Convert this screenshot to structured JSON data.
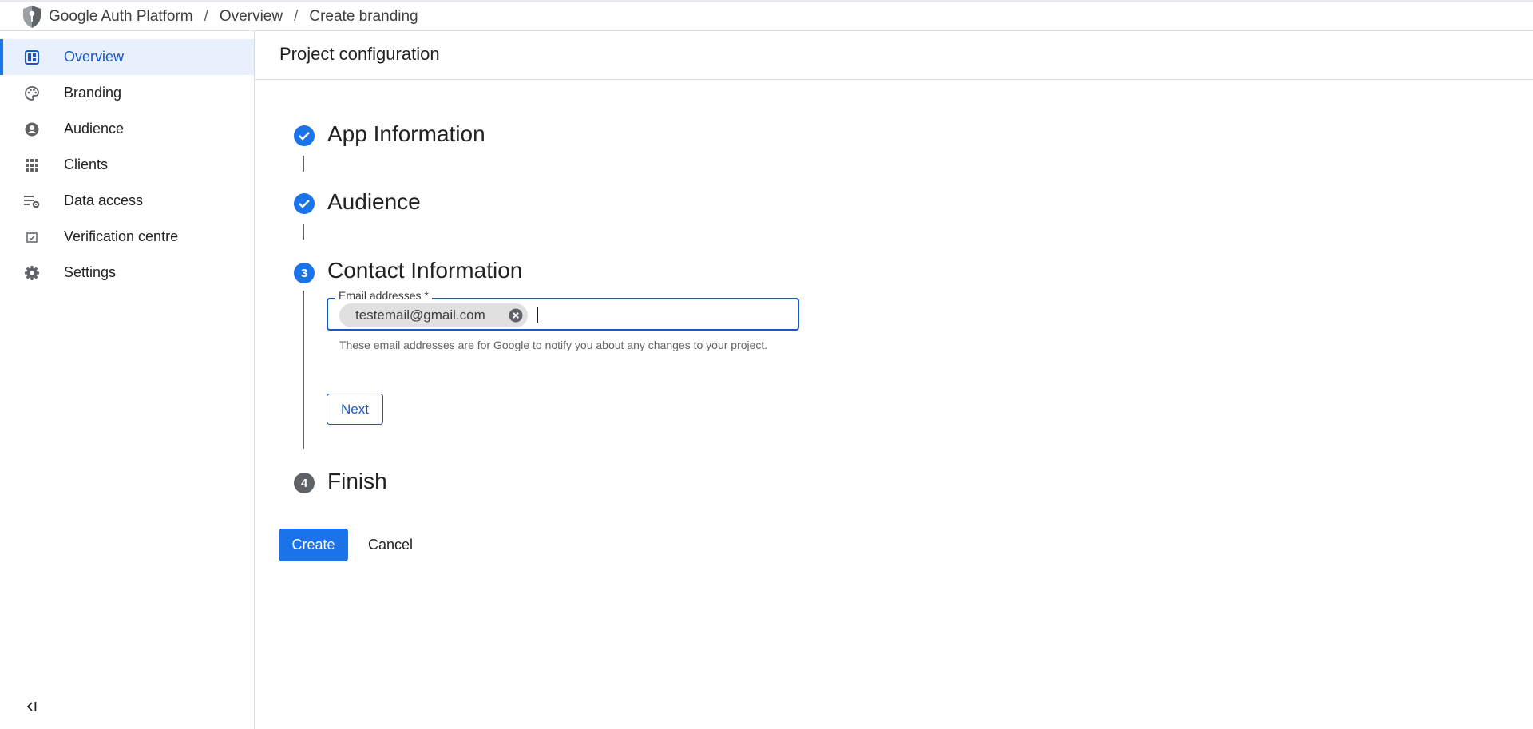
{
  "breadcrumb": {
    "items": [
      "Google Auth Platform",
      "Overview",
      "Create branding"
    ],
    "separator": "/"
  },
  "sidebar": {
    "items": [
      {
        "label": "Overview",
        "icon": "dashboard-icon",
        "active": true
      },
      {
        "label": "Branding",
        "icon": "palette-icon",
        "active": false
      },
      {
        "label": "Audience",
        "icon": "account-circle-icon",
        "active": false
      },
      {
        "label": "Clients",
        "icon": "apps-grid-icon",
        "active": false
      },
      {
        "label": "Data access",
        "icon": "data-settings-icon",
        "active": false
      },
      {
        "label": "Verification centre",
        "icon": "verified-checkbox-icon",
        "active": false
      },
      {
        "label": "Settings",
        "icon": "gear-icon",
        "active": false
      }
    ],
    "collapse_icon": "collapse-left-icon"
  },
  "page": {
    "title": "Project configuration"
  },
  "steps": [
    {
      "number": "1",
      "title": "App Information",
      "state": "done"
    },
    {
      "number": "2",
      "title": "Audience",
      "state": "done"
    },
    {
      "number": "3",
      "title": "Contact Information",
      "state": "current"
    },
    {
      "number": "4",
      "title": "Finish",
      "state": "pending"
    }
  ],
  "contact": {
    "field_label": "Email addresses *",
    "chip": "testemail@gmail.com",
    "hint": "These email addresses are for Google to notify you about any changes to your project.",
    "next_label": "Next"
  },
  "actions": {
    "create_label": "Create",
    "cancel_label": "Cancel"
  },
  "colors": {
    "accent": "#1a73e8",
    "accent_dark": "#1a56c4",
    "active_bg": "#e8f0fe",
    "pending_step": "#5f6368"
  }
}
